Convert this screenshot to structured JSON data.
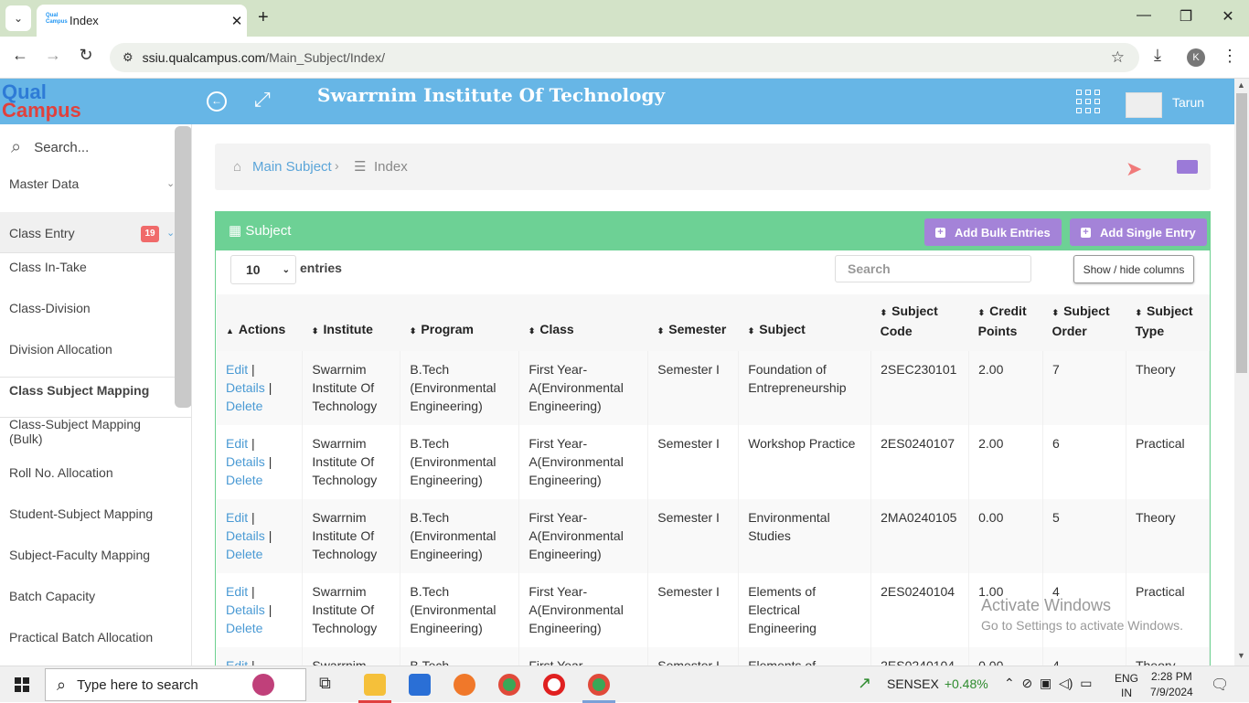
{
  "browser": {
    "tab_title": "Index",
    "url_host": "ssiu.qualcampus.com",
    "url_path": "/Main_Subject/Index/",
    "profile_initial": "K"
  },
  "header": {
    "logo_line1": "Qual",
    "logo_line2": "Campus",
    "title": "Swarrnim Institute Of Technology",
    "username": "Tarun"
  },
  "sidebar": {
    "search_placeholder": "Search...",
    "items": [
      {
        "label": "Master Data"
      },
      {
        "label": "Class Entry",
        "badge": "19"
      },
      {
        "label": "Class In-Take"
      },
      {
        "label": "Class-Division"
      },
      {
        "label": "Division Allocation"
      },
      {
        "label": "Class Subject Mapping"
      },
      {
        "label": "Class-Subject Mapping (Bulk)"
      },
      {
        "label": "Roll No. Allocation"
      },
      {
        "label": "Student-Subject Mapping"
      },
      {
        "label": "Subject-Faculty Mapping"
      },
      {
        "label": "Batch Capacity"
      },
      {
        "label": "Practical Batch Allocation"
      }
    ]
  },
  "breadcrumb": {
    "item1": "Main Subject",
    "item2": "Index"
  },
  "card": {
    "title": "Subject",
    "add_bulk": "Add Bulk Entries",
    "add_single": "Add Single Entry",
    "page_length": "10",
    "entries_label": "entries",
    "search_placeholder": "Search",
    "colvis": "Show / hide columns"
  },
  "table": {
    "headers": [
      "Actions",
      "Institute",
      "Program",
      "Class",
      "Semester",
      "Subject",
      "Subject Code",
      "Credit Points",
      "Subject Order",
      "Subject Type"
    ],
    "actions": {
      "edit": "Edit",
      "details": "Details",
      "delete": "Delete",
      "sep": "|"
    },
    "rows": [
      {
        "institute": "Swarrnim Institute Of Technology",
        "program": "B.Tech (Environmental Engineering)",
        "class": "First Year-A(Environmental Engineering)",
        "semester": "Semester I",
        "subject": "Foundation of Entrepreneurship",
        "code": "2SEC230101",
        "credit": "2.00",
        "order": "7",
        "type": "Theory"
      },
      {
        "institute": "Swarrnim Institute Of Technology",
        "program": "B.Tech (Environmental Engineering)",
        "class": "First Year-A(Environmental Engineering)",
        "semester": "Semester I",
        "subject": "Workshop Practice",
        "code": "2ES0240107",
        "credit": "2.00",
        "order": "6",
        "type": "Practical"
      },
      {
        "institute": "Swarrnim Institute Of Technology",
        "program": "B.Tech (Environmental Engineering)",
        "class": "First Year-A(Environmental Engineering)",
        "semester": "Semester I",
        "subject": "Environmental Studies",
        "code": "2MA0240105",
        "credit": "0.00",
        "order": "5",
        "type": "Theory"
      },
      {
        "institute": "Swarrnim Institute Of Technology",
        "program": "B.Tech (Environmental Engineering)",
        "class": "First Year-A(Environmental Engineering)",
        "semester": "Semester I",
        "subject": "Elements of Electrical Engineering",
        "code": "2ES0240104",
        "credit": "1.00",
        "order": "4",
        "type": "Practical"
      },
      {
        "institute": "Swarrnim",
        "program": "B.Tech",
        "class": "First Year-",
        "semester": "Semester I",
        "subject": "Elements of",
        "code": "2ES0240104",
        "credit": "0.00",
        "order": "4",
        "type": "Theory"
      }
    ]
  },
  "watermark": {
    "line1": "Activate Windows",
    "line2": "Go to Settings to activate Windows."
  },
  "taskbar": {
    "search_placeholder": "Type here to search",
    "sensex_label": "SENSEX",
    "sensex_change": "+0.48%",
    "lang1": "ENG",
    "lang2": "IN",
    "time": "2:28 PM",
    "date": "7/9/2024"
  }
}
